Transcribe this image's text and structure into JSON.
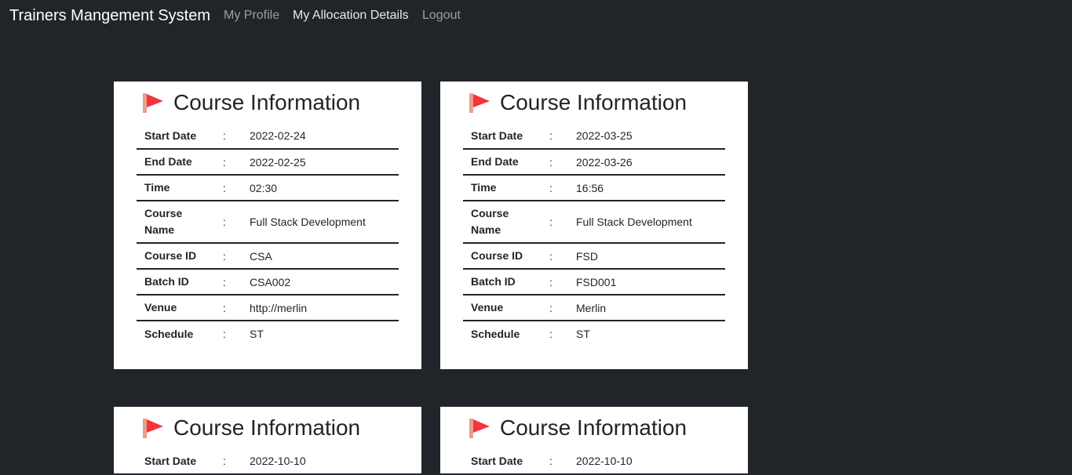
{
  "nav": {
    "brand": "Trainers Mangement System",
    "links": [
      "My Profile",
      "My Allocation Details",
      "Logout"
    ]
  },
  "cards": [
    {
      "title": "Course Information",
      "rows": [
        {
          "label": "Start Date",
          "sep": ":",
          "value": "2022-02-24"
        },
        {
          "label": "End Date",
          "sep": ":",
          "value": "2022-02-25"
        },
        {
          "label": "Time",
          "sep": ":",
          "value": "02:30"
        },
        {
          "label": "Course Name",
          "sep": ":",
          "value": "Full Stack Development"
        },
        {
          "label": "Course ID",
          "sep": ":",
          "value": "CSA"
        },
        {
          "label": "Batch ID",
          "sep": ":",
          "value": "CSA002"
        },
        {
          "label": "Venue",
          "sep": ":",
          "value": "http://merlin"
        },
        {
          "label": "Schedule",
          "sep": ":",
          "value": "ST"
        }
      ]
    },
    {
      "title": "Course Information",
      "rows": [
        {
          "label": "Start Date",
          "sep": ":",
          "value": "2022-03-25"
        },
        {
          "label": "End Date",
          "sep": ":",
          "value": "2022-03-26"
        },
        {
          "label": "Time",
          "sep": ":",
          "value": "16:56"
        },
        {
          "label": "Course Name",
          "sep": ":",
          "value": "Full Stack Development"
        },
        {
          "label": "Course ID",
          "sep": ":",
          "value": "FSD"
        },
        {
          "label": "Batch ID",
          "sep": ":",
          "value": "FSD001"
        },
        {
          "label": "Venue",
          "sep": ":",
          "value": "Merlin"
        },
        {
          "label": "Schedule",
          "sep": ":",
          "value": "ST"
        }
      ]
    },
    {
      "title": "Course Information",
      "rows": [
        {
          "label": "Start Date",
          "sep": ":",
          "value": "2022-10-10"
        }
      ]
    },
    {
      "title": "Course Information",
      "rows": [
        {
          "label": "Start Date",
          "sep": ":",
          "value": "2022-10-10"
        }
      ]
    }
  ],
  "colors": {
    "background": "#212529",
    "card": "#ffffff",
    "flag_red": "#f4343a",
    "flag_pole": "#e8a08c"
  },
  "icons": {
    "card_title_icon": "triangular-flag-icon"
  }
}
